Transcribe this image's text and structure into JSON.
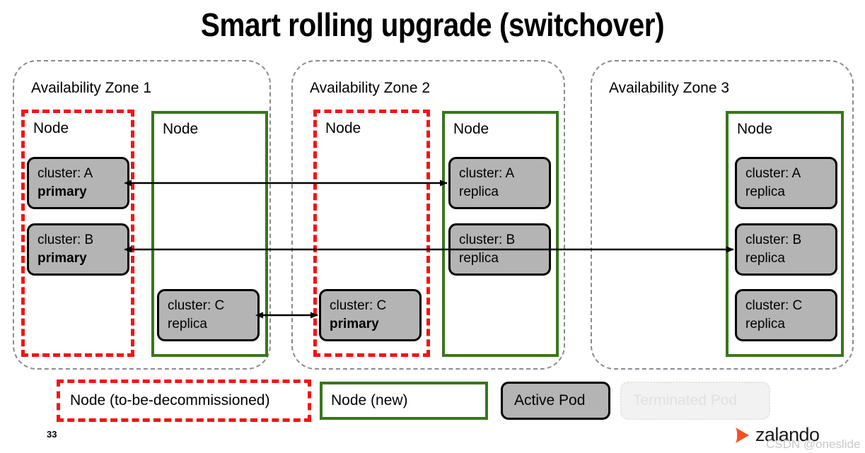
{
  "slide": {
    "title": "Smart rolling upgrade (switchover)",
    "page_number": "33"
  },
  "colors": {
    "old_node_border": "#f41414",
    "new_node_border": "#38761d",
    "zone_border": "#8a8a93",
    "pod_fill": "#b4b4b4",
    "pod_border": "#000000",
    "terminated_pod_text": "#e0e0e0",
    "brand_orange": "#f5501e"
  },
  "zones": [
    {
      "label": "Availability Zone 1",
      "nodes": [
        {
          "label": "Node",
          "state": "to-be-decommissioned",
          "pods": [
            {
              "line1": "cluster: A",
              "line2": "primary",
              "role": "primary"
            },
            {
              "line1": "cluster: B",
              "line2": "primary",
              "role": "primary"
            }
          ]
        },
        {
          "label": "Node",
          "state": "new",
          "pods": [
            {
              "line1": "cluster: C",
              "line2": "replica",
              "role": "replica"
            }
          ]
        }
      ]
    },
    {
      "label": "Availability Zone 2",
      "nodes": [
        {
          "label": "Node",
          "state": "to-be-decommissioned",
          "pods": [
            {
              "line1": "cluster: C",
              "line2": "primary",
              "role": "primary"
            }
          ]
        },
        {
          "label": "Node",
          "state": "new",
          "pods": [
            {
              "line1": "cluster: A",
              "line2": "replica",
              "role": "replica"
            },
            {
              "line1": "cluster: B",
              "line2": "replica",
              "role": "replica"
            }
          ]
        }
      ]
    },
    {
      "label": "Availability Zone 3",
      "nodes": [
        {
          "label": "Node",
          "state": "new",
          "pods": [
            {
              "line1": "cluster: A",
              "line2": "replica",
              "role": "replica"
            },
            {
              "line1": "cluster: B",
              "line2": "replica",
              "role": "replica"
            },
            {
              "line1": "cluster: C",
              "line2": "replica",
              "role": "replica"
            }
          ]
        }
      ]
    }
  ],
  "connections": [
    {
      "name": "cluster-a-replication",
      "from": "az1 cluster: A primary",
      "to": "az2 cluster: A replica",
      "heads": "both"
    },
    {
      "name": "cluster-b-replication",
      "from": "az1 cluster: B primary",
      "to": "az3 cluster: B replica",
      "heads": "both"
    },
    {
      "name": "cluster-c-replication",
      "from": "az1 cluster: C replica",
      "to": "az2 cluster: C primary",
      "heads": "both"
    }
  ],
  "legend": [
    {
      "key": "node-old",
      "label": "Node (to-be-decommissioned)"
    },
    {
      "key": "node-new",
      "label": "Node (new)"
    },
    {
      "key": "pod-active",
      "label": "Active Pod"
    },
    {
      "key": "pod-terminated",
      "label": "Terminated Pod"
    }
  ],
  "brand": {
    "name": "zalando",
    "mark": "play-triangle-icon"
  },
  "watermark": "CSDN @oneslide"
}
